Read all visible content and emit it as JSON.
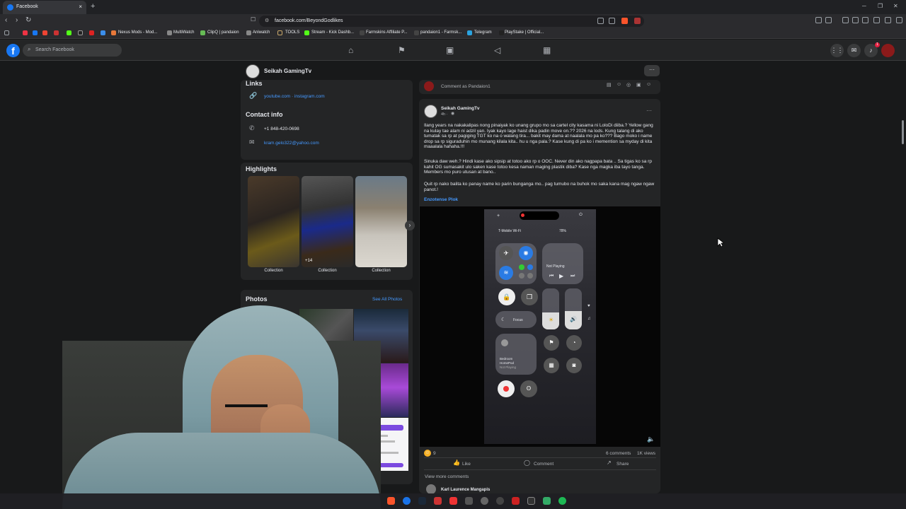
{
  "browser": {
    "tab_title": "Facebook",
    "tab_close": "×",
    "new_tab": "+",
    "url": "facebook.com/BeyondGodlikes",
    "bookmarks": [
      "Nexus Mods - Mod...",
      "MultiWatch",
      "ClipQ | pandaion",
      "Aniwatch",
      "TOOLS",
      "Stream - Kick Dashb...",
      "Farmskins Affiliate P...",
      "pandaion1 - Farmsk...",
      "Telegram",
      "PlayStake | Official..."
    ]
  },
  "facebook": {
    "search_placeholder": "Search Facebook",
    "notification_count": "1"
  },
  "page": {
    "name": "Seikah GamingTv",
    "more": "···"
  },
  "intro": {
    "links_heading": "Links",
    "links_value": "youtube.com · instagram.com",
    "contact_heading": "Contact info",
    "phone": "+1 848-420-0698",
    "email": "kram.gelo322@yahoo.com"
  },
  "highlights": {
    "heading": "Highlights",
    "items": [
      {
        "label": "Collection",
        "count": ""
      },
      {
        "label": "Collection",
        "count": "+14"
      },
      {
        "label": "Collection",
        "count": ""
      }
    ]
  },
  "photos": {
    "heading": "Photos",
    "see_all": "See All Photos"
  },
  "post": {
    "comment_placeholder": "Comment as Pandaion1",
    "author": "Seikah GamingTv",
    "time": "4h ·",
    "para1": "Ilang years na nakakalipas nong pinaiyak ko unang grupo mo sa cartel  city kasama ni LoloDi diiba.? Yellow gang na kulay tae alam ni adzil yan. Iyak kayo lage haist dika padin move on.?? 2026 na lods. Kung talang di ako tumatak sa rp at pagiging TGT ko na o walang tira... bakit may dama at naalala mo pa ko??? Bago moko i name drop sa rp siguraduhin mo munang kilala kita.. hu u nga pala.? Kase kung di pa ko i memention sa myday di kita maaalala hahaha.!!!",
    "para2": "Sinuka daw weh.? Hindi kase ako sipsip at totoo ako rp o OOC. Never din ako nagpapa bata .. Sa tigas ko sa rp kahit OG sumasakit ulo saken kase totoo kesa naman maging plastik diba? Kase nga magka iba tayo tanga. Members mo puro  utusan at bano..",
    "para3": "Quit rp nako balita ko panay name ko parin bunganga mo.. pag tumubo na buhok mo saka kana mag ngaw ngaw panot.!",
    "tag": "Enzotense Plok",
    "reactions": "9",
    "comments": "6 comments",
    "views": "1K views",
    "like": "Like",
    "comment": "Comment",
    "share": "Share",
    "view_more": "View more comments",
    "commenter": "Karl Laurence Mangapis"
  },
  "phone_screen": {
    "carrier": "T-Mobile Wi-Fi",
    "battery": "78%",
    "now_playing": "Not Playing",
    "focus": "Focus",
    "homepod_line1": "Bedroom",
    "homepod_line2": "HomePod",
    "homepod_line3": "Not Playing"
  }
}
